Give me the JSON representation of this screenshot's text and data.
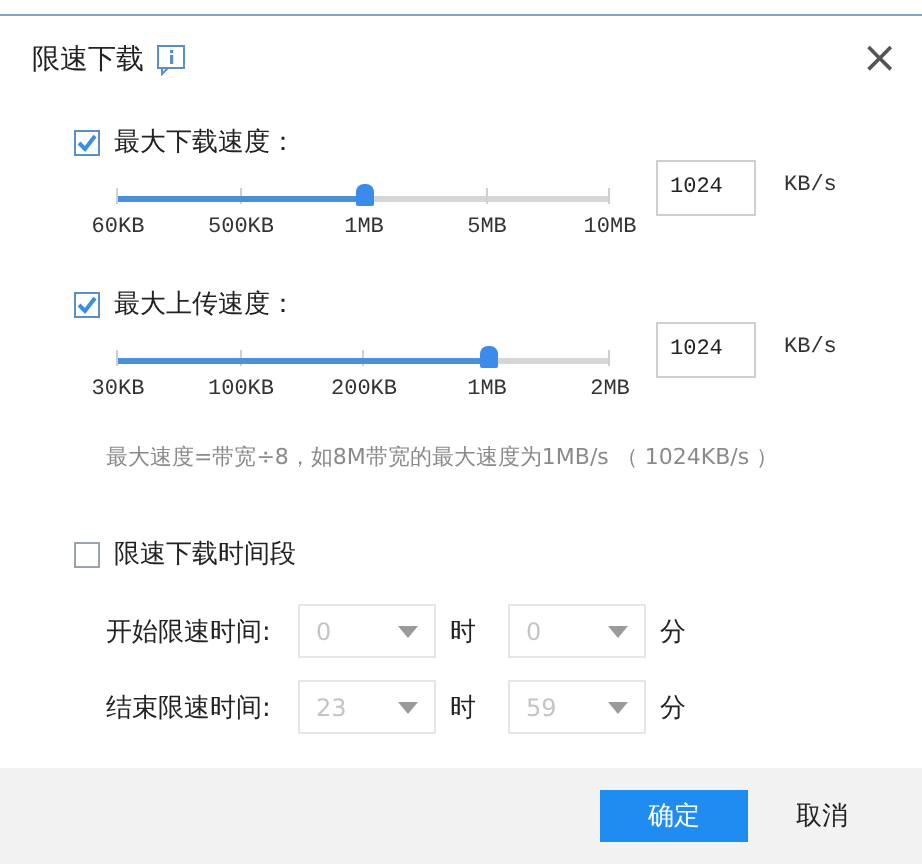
{
  "window": {
    "title": "限速下载",
    "close": "×"
  },
  "limits": [
    {
      "label": "最大下载速度：",
      "checked": true,
      "ticks": [
        "60KB",
        "500KB",
        "1MB",
        "5MB",
        "10MB"
      ],
      "level": 0.5,
      "value": "1024",
      "unit": "KB/s"
    },
    {
      "label": "最大上传速度：",
      "checked": true,
      "ticks": [
        "30KB",
        "100KB",
        "200KB",
        "1MB",
        "2MB"
      ],
      "level": 0.75,
      "value": "1024",
      "unit": "KB/s"
    }
  ],
  "note": "最大速度=带宽÷8，如8M带宽的最大速度为1MB/s （ 1024KB/s ）",
  "schedule": {
    "label": "限速下载时间段",
    "checked": false,
    "rows": [
      {
        "label": "开始限速时间:",
        "hour": "0",
        "hour_unit": "时",
        "minute": "0",
        "minute_unit": "分"
      },
      {
        "label": "结束限速时间:",
        "hour": "23",
        "hour_unit": "时",
        "minute": "59",
        "minute_unit": "分"
      }
    ]
  },
  "buttons": [
    {
      "label": "确定",
      "kind": "primary"
    },
    {
      "label": "取消",
      "kind": "secondary"
    }
  ]
}
